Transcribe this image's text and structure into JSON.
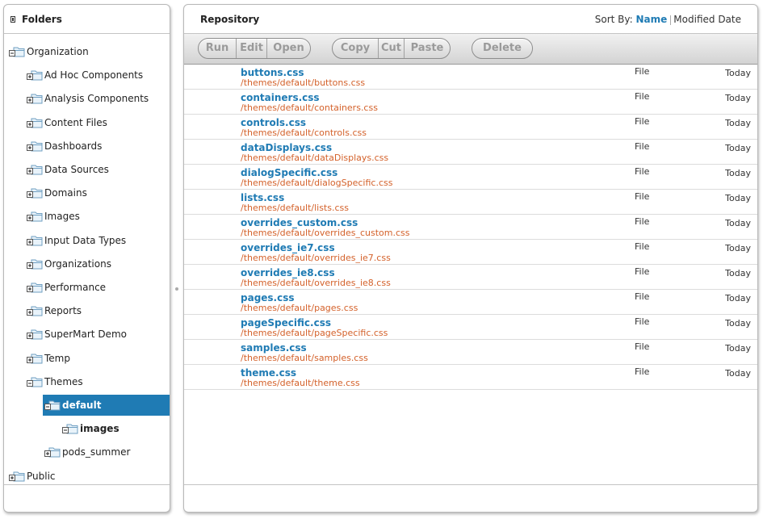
{
  "folders": {
    "title": "Folders",
    "tree": [
      {
        "label": "Organization",
        "depth": 0,
        "expanded": true,
        "selected": false,
        "bold": false,
        "expander": "minus",
        "icon": "folder-icon"
      },
      {
        "label": "Ad Hoc Components",
        "depth": 1,
        "expanded": false,
        "selected": false,
        "bold": false,
        "expander": "plus",
        "icon": "folder-icon"
      },
      {
        "label": "Analysis Components",
        "depth": 1,
        "expanded": false,
        "selected": false,
        "bold": false,
        "expander": "plus",
        "icon": "folder-icon"
      },
      {
        "label": "Content Files",
        "depth": 1,
        "expanded": false,
        "selected": false,
        "bold": false,
        "expander": "plus",
        "icon": "folder-icon"
      },
      {
        "label": "Dashboards",
        "depth": 1,
        "expanded": false,
        "selected": false,
        "bold": false,
        "expander": "plus",
        "icon": "folder-icon"
      },
      {
        "label": "Data Sources",
        "depth": 1,
        "expanded": false,
        "selected": false,
        "bold": false,
        "expander": "plus",
        "icon": "folder-icon"
      },
      {
        "label": "Domains",
        "depth": 1,
        "expanded": false,
        "selected": false,
        "bold": false,
        "expander": "plus",
        "icon": "folder-icon"
      },
      {
        "label": "Images",
        "depth": 1,
        "expanded": false,
        "selected": false,
        "bold": false,
        "expander": "plus",
        "icon": "folder-icon"
      },
      {
        "label": "Input Data Types",
        "depth": 1,
        "expanded": false,
        "selected": false,
        "bold": false,
        "expander": "plus",
        "icon": "folder-icon"
      },
      {
        "label": "Organizations",
        "depth": 1,
        "expanded": false,
        "selected": false,
        "bold": false,
        "expander": "plus",
        "icon": "folder-icon"
      },
      {
        "label": "Performance",
        "depth": 1,
        "expanded": false,
        "selected": false,
        "bold": false,
        "expander": "plus",
        "icon": "folder-icon"
      },
      {
        "label": "Reports",
        "depth": 1,
        "expanded": false,
        "selected": false,
        "bold": false,
        "expander": "plus",
        "icon": "folder-icon"
      },
      {
        "label": "SuperMart Demo",
        "depth": 1,
        "expanded": false,
        "selected": false,
        "bold": false,
        "expander": "plus",
        "icon": "folder-icon"
      },
      {
        "label": "Temp",
        "depth": 1,
        "expanded": false,
        "selected": false,
        "bold": false,
        "expander": "plus",
        "icon": "folder-icon"
      },
      {
        "label": "Themes",
        "depth": 1,
        "expanded": true,
        "selected": false,
        "bold": false,
        "expander": "minus",
        "icon": "folder-icon"
      },
      {
        "label": "default",
        "depth": 2,
        "expanded": true,
        "selected": true,
        "bold": true,
        "expander": "minus",
        "icon": "folder-open-icon"
      },
      {
        "label": "images",
        "depth": 3,
        "expanded": true,
        "selected": false,
        "bold": true,
        "expander": "minus",
        "icon": "folder-icon"
      },
      {
        "label": "pods_summer",
        "depth": 2,
        "expanded": false,
        "selected": false,
        "bold": false,
        "expander": "plus",
        "icon": "folder-icon"
      },
      {
        "label": "Public",
        "depth": 0,
        "expanded": false,
        "selected": false,
        "bold": false,
        "expander": "plus",
        "icon": "folder-icon"
      }
    ]
  },
  "repository": {
    "title": "Repository",
    "sort_by_label": "Sort By:",
    "sort_options": [
      "Name",
      "Modified Date"
    ],
    "sort_active": "Name",
    "toolbar_groups": [
      {
        "buttons": [
          "Run",
          "Edit",
          "Open"
        ]
      },
      {
        "buttons": [
          "Copy",
          "Cut",
          "Paste"
        ]
      },
      {
        "buttons": [
          "Delete"
        ]
      }
    ],
    "results": [
      {
        "name": "buttons.css",
        "path": "/themes/default/buttons.css",
        "type": "File",
        "date": "Today"
      },
      {
        "name": "containers.css",
        "path": "/themes/default/containers.css",
        "type": "File",
        "date": "Today"
      },
      {
        "name": "controls.css",
        "path": "/themes/default/controls.css",
        "type": "File",
        "date": "Today"
      },
      {
        "name": "dataDisplays.css",
        "path": "/themes/default/dataDisplays.css",
        "type": "File",
        "date": "Today"
      },
      {
        "name": "dialogSpecific.css",
        "path": "/themes/default/dialogSpecific.css",
        "type": "File",
        "date": "Today"
      },
      {
        "name": "lists.css",
        "path": "/themes/default/lists.css",
        "type": "File",
        "date": "Today"
      },
      {
        "name": "overrides_custom.css",
        "path": "/themes/default/overrides_custom.css",
        "type": "File",
        "date": "Today"
      },
      {
        "name": "overrides_ie7.css",
        "path": "/themes/default/overrides_ie7.css",
        "type": "File",
        "date": "Today"
      },
      {
        "name": "overrides_ie8.css",
        "path": "/themes/default/overrides_ie8.css",
        "type": "File",
        "date": "Today"
      },
      {
        "name": "pages.css",
        "path": "/themes/default/pages.css",
        "type": "File",
        "date": "Today"
      },
      {
        "name": "pageSpecific.css",
        "path": "/themes/default/pageSpecific.css",
        "type": "File",
        "date": "Today"
      },
      {
        "name": "samples.css",
        "path": "/themes/default/samples.css",
        "type": "File",
        "date": "Today"
      },
      {
        "name": "theme.css",
        "path": "/themes/default/theme.css",
        "type": "File",
        "date": "Today"
      }
    ]
  },
  "colors": {
    "accent": "#1f7bb4",
    "path_text": "#d4612a",
    "selected_bg": "#1f7bb4",
    "disabled_button_text": "#9a9a9a"
  }
}
